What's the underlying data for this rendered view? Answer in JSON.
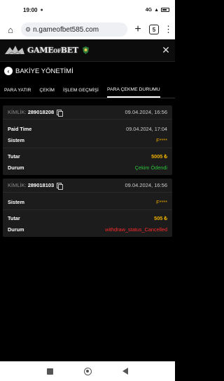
{
  "status_bar": {
    "time": "19:00",
    "signal_text": "4G",
    "battery_icon": "battery-icon"
  },
  "browser": {
    "url": "n.gameofbet585.com",
    "tab_count": "5"
  },
  "site": {
    "logo_text_a": "GAME",
    "logo_text_of": "OF",
    "logo_text_b": "BET",
    "colors": {
      "background": "#000000",
      "card": "#1c1c1c"
    }
  },
  "page": {
    "title": "BAKİYE YÖNETİMİ"
  },
  "tabs": [
    {
      "label": "PARA YATIR"
    },
    {
      "label": "ÇEKİM"
    },
    {
      "label": "İŞLEM GEÇMİŞİ"
    },
    {
      "label": "PARA ÇEKME DURUMU",
      "active": true
    }
  ],
  "transactions": [
    {
      "id_label": "KİMLİK:",
      "id": "289018208",
      "date": "09.04.2024, 16:56",
      "paid_time_label": "Paid Time",
      "paid_time": "09.04.2024, 17:04",
      "system_label": "Sistem",
      "system": "F****",
      "amount_label": "Tutar",
      "amount": "5005 ₺",
      "status_label": "Durum",
      "status": "Çekim Ödendi",
      "status_color": "#2bc23a"
    },
    {
      "id_label": "KİMLİK:",
      "id": "289018103",
      "date": "09.04.2024, 16:56",
      "system_label": "Sistem",
      "system": "F****",
      "amount_label": "Tutar",
      "amount": "505 ₺",
      "status_label": "Durum",
      "status": "withdraw_status_Cancelled",
      "status_color": "#ff2a2a"
    }
  ]
}
